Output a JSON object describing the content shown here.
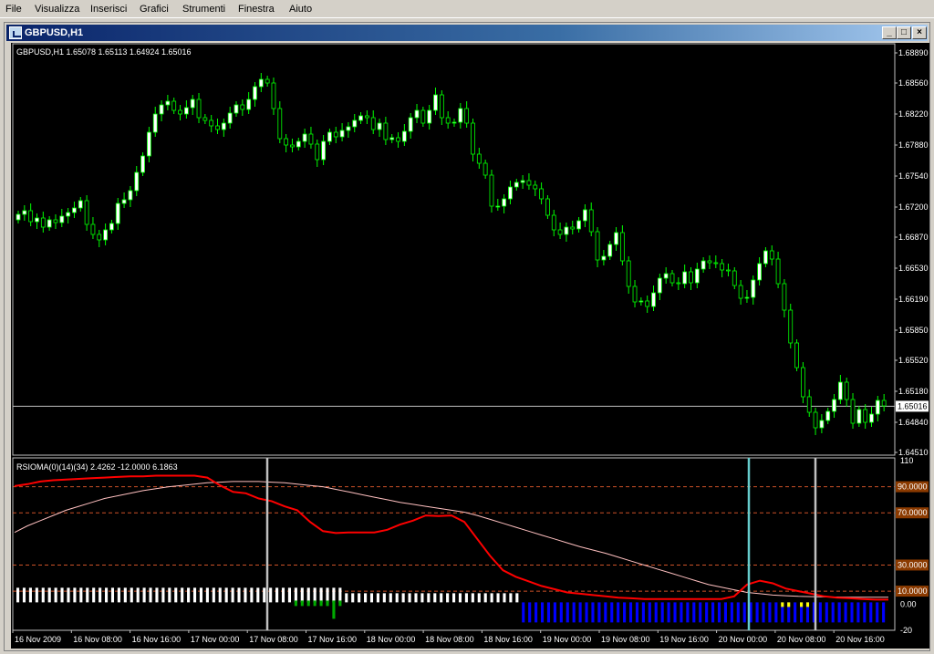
{
  "menu": {
    "items": [
      {
        "label": "File"
      },
      {
        "label": "Visualizza"
      },
      {
        "label": "Inserisci"
      },
      {
        "label": "Grafici"
      },
      {
        "label": "Strumenti"
      },
      {
        "label": "Finestra"
      },
      {
        "label": "Aiuto"
      }
    ]
  },
  "window": {
    "title": "GBPUSD,H1"
  },
  "colors": {
    "background": "#000000",
    "bull_candle": "#ffffff",
    "bear_candle": "#000000",
    "candle_outline": "#00ff00",
    "rsioma_line": "#ff0000",
    "signal_line": "#ffc0c0",
    "level_line": "#ff6633",
    "marker_white": "#c0c0c0",
    "marker_cyan": "#66cccc",
    "hist_white": "#ffffff",
    "hist_green": "#00aa00",
    "hist_blue": "#0000ff",
    "hist_yellow": "#ffff00"
  },
  "chart_data": [
    {
      "type": "candlestick",
      "title": "GBPUSD,H1  1.65078 1.65113 1.64924 1.65016",
      "symbol": "GBPUSD",
      "timeframe": "H1",
      "last_bar": {
        "open": 1.65078,
        "high": 1.65113,
        "low": 1.64924,
        "close": 1.65016
      },
      "current_price_label": "1.65016",
      "ylim": [
        1.6451,
        1.6889
      ],
      "y_ticks": [
        "1.68890",
        "1.68560",
        "1.68220",
        "1.67880",
        "1.67540",
        "1.67200",
        "1.66870",
        "1.66530",
        "1.66190",
        "1.65850",
        "1.65520",
        "1.65180",
        "1.64840",
        "1.64510"
      ],
      "closes": [
        1.6712,
        1.6716,
        1.6704,
        1.6708,
        1.6698,
        1.6706,
        1.6703,
        1.671,
        1.6714,
        1.6719,
        1.6727,
        1.6701,
        1.669,
        1.6684,
        1.6695,
        1.6702,
        1.6724,
        1.6728,
        1.6738,
        1.6758,
        1.6776,
        1.6802,
        1.6822,
        1.6832,
        1.6836,
        1.6826,
        1.6822,
        1.6829,
        1.6838,
        1.6818,
        1.6815,
        1.6809,
        1.6805,
        1.6812,
        1.6823,
        1.6832,
        1.6827,
        1.6838,
        1.6852,
        1.686,
        1.6856,
        1.6828,
        1.6795,
        1.6788,
        1.6786,
        1.6792,
        1.68,
        1.6789,
        1.6772,
        1.6792,
        1.6802,
        1.6797,
        1.6804,
        1.6808,
        1.6815,
        1.682,
        1.6818,
        1.6805,
        1.6812,
        1.6794,
        1.6796,
        1.6792,
        1.6803,
        1.6818,
        1.6826,
        1.6812,
        1.6826,
        1.6843,
        1.6818,
        1.6812,
        1.6813,
        1.6828,
        1.6812,
        1.6778,
        1.6768,
        1.6755,
        1.6721,
        1.6721,
        1.6729,
        1.6742,
        1.6747,
        1.6749,
        1.6744,
        1.674,
        1.6729,
        1.6711,
        1.6695,
        1.669,
        1.6698,
        1.6696,
        1.6705,
        1.6717,
        1.6693,
        1.6662,
        1.6666,
        1.6679,
        1.6692,
        1.6661,
        1.6633,
        1.6616,
        1.6617,
        1.6611,
        1.6626,
        1.6642,
        1.6647,
        1.6637,
        1.6636,
        1.6649,
        1.6637,
        1.6652,
        1.6661,
        1.6659,
        1.6658,
        1.6651,
        1.665,
        1.6634,
        1.662,
        1.6621,
        1.664,
        1.6658,
        1.6672,
        1.6663,
        1.6636,
        1.6607,
        1.6571,
        1.6544,
        1.6512,
        1.6495,
        1.6478,
        1.6486,
        1.6496,
        1.6509,
        1.6528,
        1.6509,
        1.6483,
        1.6498,
        1.6484,
        1.6493,
        1.6508,
        1.6502
      ],
      "x_ticks": [
        "16 Nov 2009",
        "16 Nov 08:00",
        "16 Nov 16:00",
        "17 Nov 00:00",
        "17 Nov 08:00",
        "17 Nov 16:00",
        "18 Nov 00:00",
        "18 Nov 08:00",
        "18 Nov 16:00",
        "19 Nov 00:00",
        "19 Nov 08:00",
        "19 Nov 16:00",
        "20 Nov 00:00",
        "20 Nov 08:00",
        "20 Nov 16:00"
      ]
    },
    {
      "type": "line",
      "title": "RSIOMA(0)(14)(34) 2.4262 -12.0000 6.1863",
      "ylim": [
        -20,
        110
      ],
      "y_ticks": [
        "110",
        "0.00",
        "-20"
      ],
      "levels": [
        {
          "label": "90.0000",
          "value": 90
        },
        {
          "label": "70.0000",
          "value": 70
        },
        {
          "label": "30.0000",
          "value": 30
        },
        {
          "label": "10.0000",
          "value": 10
        }
      ],
      "series": [
        {
          "key": "rsioma",
          "values": [
            90.5,
            92,
            94,
            95,
            95.5,
            96,
            96.5,
            97,
            97.5,
            98,
            98,
            98.5,
            98.5,
            98.5,
            98.5,
            97,
            91,
            86,
            85,
            81,
            79,
            75,
            72,
            63,
            56,
            54.5,
            55,
            55,
            55,
            57,
            61,
            64,
            68,
            67.5,
            68,
            63,
            50,
            37,
            26,
            21,
            17.5,
            14,
            11.5,
            9,
            8,
            7,
            6,
            5,
            4.5,
            4,
            4,
            4,
            4,
            4,
            4,
            4,
            6,
            15,
            18,
            16,
            12,
            10,
            8,
            6,
            5,
            4.5,
            4,
            3.5,
            3.5
          ]
        },
        {
          "key": "signal",
          "values": [
            55,
            60,
            64,
            68,
            72,
            75,
            78,
            81,
            83,
            85,
            87,
            88.5,
            90,
            91,
            92,
            93,
            93.5,
            94,
            94,
            94,
            93.5,
            93,
            92,
            91,
            90,
            88,
            86,
            84,
            82,
            80,
            78,
            76.5,
            75,
            73.5,
            72,
            70.5,
            68,
            65,
            62,
            59,
            56,
            53,
            50,
            47,
            44,
            41.5,
            39,
            36,
            33,
            30,
            27,
            24,
            21,
            18,
            15,
            13,
            11,
            9,
            8,
            7,
            6.5,
            6,
            5.8,
            5.6,
            5.5,
            5.4,
            5.3,
            5.3,
            5.3
          ]
        }
      ],
      "histogram_colors": [
        "w",
        "w",
        "w",
        "w",
        "w",
        "w",
        "w",
        "w",
        "w",
        "w",
        "w",
        "w",
        "w",
        "w",
        "w",
        "w",
        "w",
        "w",
        "w",
        "w",
        "w",
        "w",
        "w",
        "w",
        "w",
        "w",
        "w",
        "w",
        "w",
        "w",
        "w",
        "w",
        "w",
        "w",
        "w",
        "w",
        "w",
        "w",
        "w",
        "w",
        "w",
        "w",
        "w",
        "w",
        "w",
        "w",
        "w",
        "w",
        "w",
        "w",
        "w",
        "w",
        "w",
        "w",
        "w",
        "w",
        "w",
        "w",
        "w",
        "w",
        "w",
        "w",
        "w",
        "w",
        "w",
        "w",
        "w",
        "w",
        "w",
        "w",
        "w",
        "w",
        "w",
        "w",
        "w",
        "w",
        "w",
        "w",
        "w",
        "w",
        "w",
        "w",
        "w",
        "w",
        "w",
        "w",
        "w",
        "w",
        "w",
        "w",
        "w",
        "w",
        "w",
        "w",
        "w",
        "w",
        "w",
        "w",
        "w",
        "w",
        "w",
        "w",
        "w",
        "w",
        "w",
        "w",
        "w",
        "w",
        "w",
        "w",
        "w",
        "w",
        "w",
        "w",
        "w",
        "w",
        "w",
        "w",
        "w",
        "w",
        "w",
        "w",
        "w",
        "w",
        "w",
        "w",
        "w",
        "w",
        "w",
        "w",
        "w",
        "w",
        "w",
        "w",
        "w",
        "w",
        "w",
        "w",
        "w",
        "w",
        "w",
        "w",
        "w",
        "w",
        "w",
        "w",
        "w",
        "w",
        "w",
        "w",
        "w",
        "w",
        "w",
        "w",
        "w",
        "w",
        "w",
        "w",
        "w",
        "w",
        "w",
        "w",
        "w",
        "w",
        "w",
        "w",
        "w",
        "w",
        "w",
        "w",
        "w",
        "w",
        "w",
        "w",
        "w",
        "w",
        "w",
        "w",
        "w",
        "w",
        "w",
        "w",
        "w",
        "w",
        "w",
        "w",
        "w",
        "w",
        "w",
        "w",
        "w",
        "w",
        "w",
        "w",
        "w",
        "w",
        "w",
        "w",
        "w",
        "w",
        "w",
        "w",
        "w",
        "w",
        "w",
        "w",
        "w",
        "w",
        "w",
        "w",
        "w",
        "w",
        "w",
        "w",
        "w",
        "w",
        "w",
        "w",
        "w",
        "w",
        "w",
        "w",
        "w",
        "w",
        "w",
        "w",
        "w",
        "w",
        "w",
        "w",
        "w",
        "w",
        "w"
      ]
    }
  ]
}
